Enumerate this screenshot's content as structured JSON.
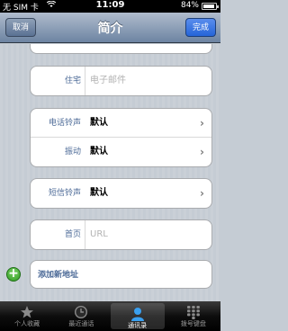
{
  "status_bar": {
    "carrier": "无 SIM 卡",
    "time": "11:09",
    "battery": "84%"
  },
  "nav": {
    "cancel": "取消",
    "title": "简介",
    "done": "完成"
  },
  "form": {
    "home_email": {
      "label": "住宅",
      "placeholder": "电子邮件"
    },
    "ringtone": {
      "label": "电话铃声",
      "value": "默认"
    },
    "vibration": {
      "label": "振动",
      "value": "默认"
    },
    "text_tone": {
      "label": "短信铃声",
      "value": "默认"
    },
    "homepage": {
      "label": "首页",
      "placeholder": "URL"
    },
    "add_address": "添加新地址"
  },
  "tabs": [
    {
      "label": "个人收藏",
      "icon": "star-icon"
    },
    {
      "label": "最近通话",
      "icon": "clock-icon"
    },
    {
      "label": "通讯录",
      "icon": "contacts-icon"
    },
    {
      "label": "拨号键盘",
      "icon": "keypad-icon"
    }
  ],
  "active_tab": 2
}
